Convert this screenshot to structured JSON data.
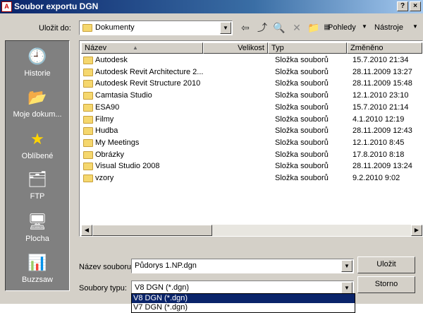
{
  "window": {
    "title": "Soubor exportu DGN",
    "app_icon": "autocad-icon"
  },
  "lookin": {
    "label": "Uložit do:",
    "value": "Dokumenty"
  },
  "toolbar": {
    "views_label": "Pohledy",
    "tools_label": "Nástroje"
  },
  "places": [
    {
      "label": "Historie",
      "icon": "history-icon"
    },
    {
      "label": "Moje dokum...",
      "icon": "my-documents-icon"
    },
    {
      "label": "Oblíbené",
      "icon": "favorites-icon"
    },
    {
      "label": "FTP",
      "icon": "ftp-icon"
    },
    {
      "label": "Plocha",
      "icon": "desktop-icon"
    },
    {
      "label": "Buzzsaw",
      "icon": "buzzsaw-icon"
    }
  ],
  "columns": {
    "name": "Název",
    "size": "Velikost",
    "type": "Typ",
    "modified": "Změněno"
  },
  "files": [
    {
      "name": "Autodesk",
      "type": "Složka souborů",
      "modified": "15.7.2010 21:34"
    },
    {
      "name": "Autodesk Revit Architecture 2...",
      "type": "Složka souborů",
      "modified": "28.11.2009 13:27"
    },
    {
      "name": "Autodesk Revit Structure 2010",
      "type": "Složka souborů",
      "modified": "28.11.2009 15:48"
    },
    {
      "name": "Camtasia Studio",
      "type": "Složka souborů",
      "modified": "12.1.2010 23:10"
    },
    {
      "name": "ESA90",
      "type": "Složka souborů",
      "modified": "15.7.2010 21:14"
    },
    {
      "name": "Filmy",
      "type": "Složka souborů",
      "modified": "4.1.2010 12:19"
    },
    {
      "name": "Hudba",
      "type": "Složka souborů",
      "modified": "28.11.2009 12:43"
    },
    {
      "name": "My Meetings",
      "type": "Složka souborů",
      "modified": "12.1.2010 8:45"
    },
    {
      "name": "Obrázky",
      "type": "Složka souborů",
      "modified": "17.8.2010 8:18"
    },
    {
      "name": "Visual Studio 2008",
      "type": "Složka souborů",
      "modified": "28.11.2009 13:24"
    },
    {
      "name": "vzory",
      "type": "Složka souborů",
      "modified": "9.2.2010 9:02"
    }
  ],
  "filename": {
    "label": "Název souboru:",
    "value": "Půdorys 1.NP.dgn"
  },
  "filetype": {
    "label": "Soubory typu:",
    "value": "V8 DGN (*.dgn)",
    "options": [
      "V8 DGN (*.dgn)",
      "V7 DGN (*.dgn)"
    ]
  },
  "buttons": {
    "save": "Uložit",
    "cancel": "Storno"
  },
  "colors": {
    "title_bar": "#0a246a",
    "selection": "#0a246a",
    "folder": "#f5d76e",
    "places_bg": "#808080"
  }
}
